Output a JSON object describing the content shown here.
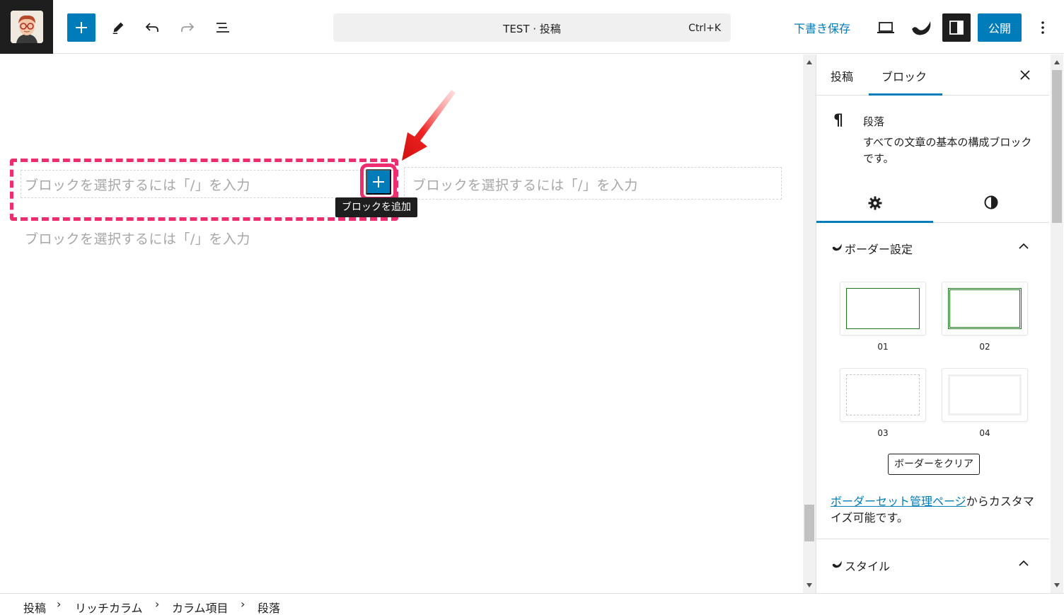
{
  "header": {
    "command_title": "TEST · 投稿",
    "command_shortcut": "Ctrl+K",
    "save_draft": "下書き保存",
    "publish": "公開"
  },
  "canvas": {
    "placeholder_left": "ブロックを選択するには「/」を入力",
    "placeholder_right": "ブロックを選択するには「/」を入力",
    "placeholder_below": "ブロックを選択するには「/」を入力",
    "tooltip": "ブロックを追加"
  },
  "sidebar": {
    "tabs": [
      "投稿",
      "ブロック"
    ],
    "block_title": "段落",
    "block_description": "すべての文章の基本の構成ブロックです。",
    "panel_border": "ボーダー設定",
    "presets": [
      "01",
      "02",
      "03",
      "04"
    ],
    "clear_button": "ボーダーをクリア",
    "help_link": "ボーダーセット管理ページ",
    "help_rest": "からカスタマイズ可能です。",
    "panel_style": "スタイル"
  },
  "breadcrumb": [
    "投稿",
    "リッチカラム",
    "カラム項目",
    "段落"
  ],
  "colors": {
    "accent": "#007cba",
    "highlight": "#ed2d6e",
    "preset_green": "#1e7a1e"
  }
}
